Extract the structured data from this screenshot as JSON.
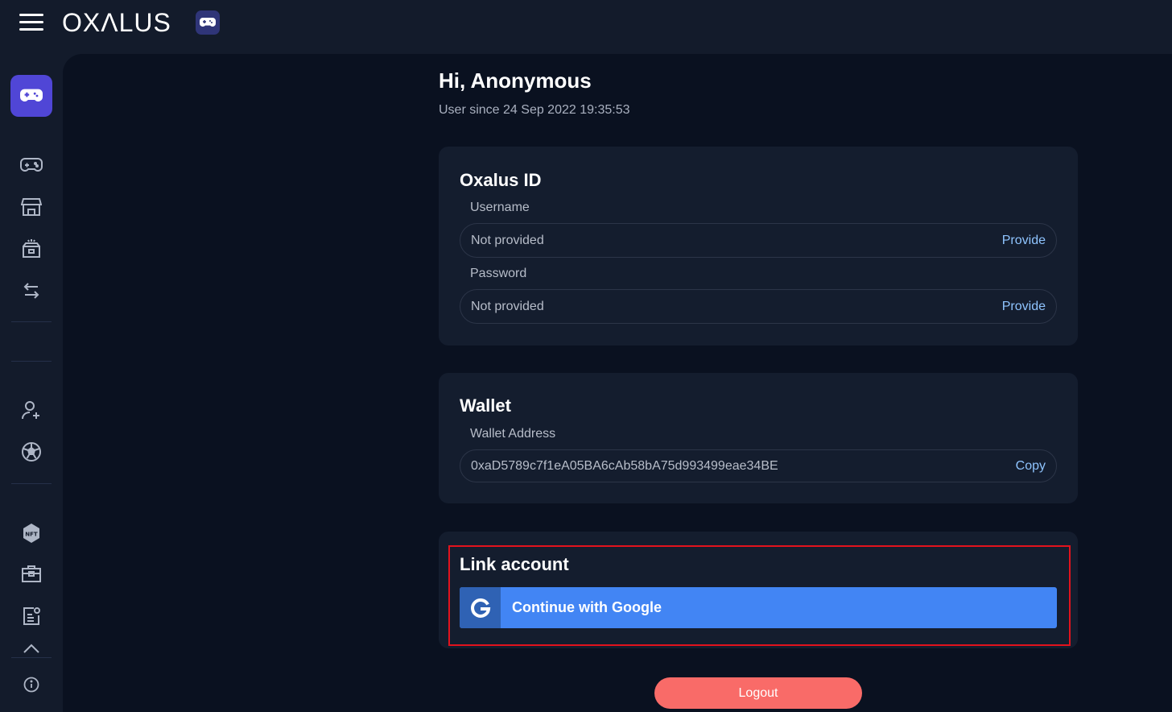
{
  "app": {
    "logo_text": "OXΛLUS",
    "hamburger_icon": "menu-icon",
    "logo_badge_icon": "gamepad-icon"
  },
  "sidebar": {
    "active_icon": "gamepad-icon",
    "items": [
      {
        "icon": "gamepad-icon"
      },
      {
        "icon": "store-icon"
      },
      {
        "icon": "chest-icon"
      },
      {
        "icon": "swap-arrows-icon"
      },
      {
        "icon": "add-user-icon"
      },
      {
        "icon": "soccer-ball-icon"
      },
      {
        "icon": "nft-badge-icon"
      },
      {
        "icon": "toolbox-icon"
      },
      {
        "icon": "settings-list-icon"
      },
      {
        "icon": "chevron-up-icon"
      },
      {
        "icon": "info-icon"
      }
    ]
  },
  "profile": {
    "greeting": "Hi, Anonymous",
    "user_since": "User since 24 Sep 2022 19:35:53"
  },
  "oxalus_id": {
    "title": "Oxalus ID",
    "username_label": "Username",
    "username_value": "Not provided",
    "username_action": "Provide",
    "password_label": "Password",
    "password_value": "Not provided",
    "password_action": "Provide"
  },
  "wallet": {
    "title": "Wallet",
    "address_label": "Wallet Address",
    "address_value": "0xaD5789c7f1eA05BA6cAb58bA75d993499eae34BE",
    "copy_action": "Copy"
  },
  "link_account": {
    "title": "Link account",
    "google_button": "Continue with Google",
    "google_icon": "google-g-icon"
  },
  "logout_label": "Logout",
  "colors": {
    "accent": "#5046d6",
    "link": "#8fc4ff",
    "google": "#4285f4",
    "logout": "#f96b68",
    "highlight": "#e3121d"
  }
}
